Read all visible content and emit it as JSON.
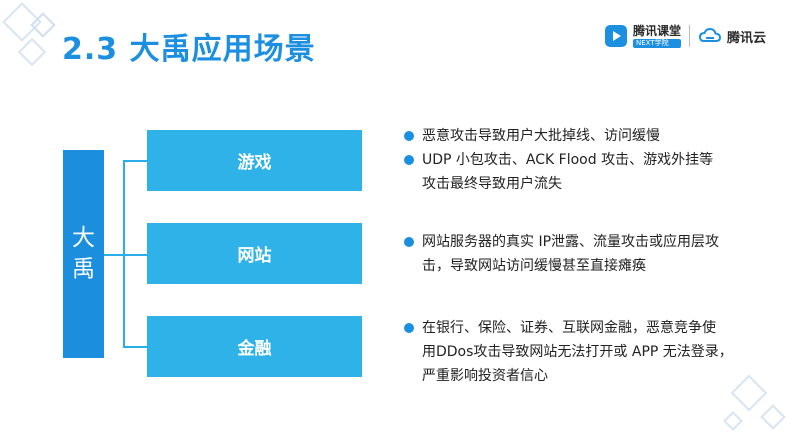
{
  "slide": {
    "title": "2.3  大禹应用场景"
  },
  "logos": {
    "ketang_name": "腾讯课堂",
    "ketang_sub": "NEXT学院",
    "cloud_name": "腾讯云"
  },
  "diagram": {
    "root_label_line1": "大",
    "root_label_line2": "禹",
    "categories": [
      {
        "label": "游戏"
      },
      {
        "label": "网站"
      },
      {
        "label": "金融"
      }
    ]
  },
  "descriptions": {
    "games": [
      {
        "line1": "恶意攻击导致用户大批掉线、访问缓慢",
        "line2": ""
      },
      {
        "line1": "UDP 小包攻击、ACK Flood 攻击、游戏外挂等",
        "line2": "攻击最终导致用户流失"
      }
    ],
    "websites": [
      {
        "line1": "网站服务器的真实 IP泄露、流量攻击或应用层攻",
        "line2": "击，导致网站访问缓慢甚至直接瘫痪"
      }
    ],
    "finance": [
      {
        "line1": "在银行、保险、证券、互联网金融，恶意竞争使",
        "line2": "用DDos攻击导致网站无法打开或 APP 无法登录，",
        "line3": "严重影响投资者信心"
      }
    ]
  }
}
